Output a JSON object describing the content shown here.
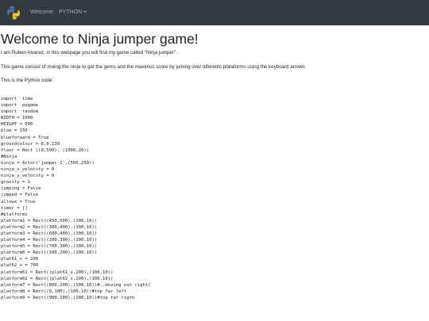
{
  "nav": {
    "items": [
      {
        "label": "Welcome"
      },
      {
        "label": "PYTHON"
      }
    ]
  },
  "page": {
    "title": "Welcome to Ninja jumper game!",
    "intro": "I am Ruben Alvarez, in this webpage you will find my game called \"Ninja jumper\" .",
    "description": "This game consist of moing the ninja to get the gems and the maximus score by juming over diferents plataforms using the keyboard arrows",
    "code_label": "This is the Python code:"
  },
  "code_lines": [
    "import  time",
    "import  pygame",
    "import  random",
    "WIDTH = 1000",
    "HEIGHT = 600",
    "blue = 150",
    "blueforward = True",
    "groundcolour = 0,0,139",
    "floor = Rect ((0,500), (1000,20))",
    "#Ninja",
    "ninja = Actor('jumper-1',(500,250))",
    "ninja_x_velocity = 0",
    "ninja_y_velocity = 0",
    "gravity = 1",
    "jumping = False",
    "jumped = False",
    "allowx = True",
    "timer = []",
    "#platforms",
    "platform1 = Rect((450,500),(100,10))",
    "platform2 = Rect((300,400),(100,10))",
    "platform3 = Rect((600,400),(100,10))",
    "platform4 = Rect((200,300),(100,10))",
    "platform5 = Rect((700,300),(100,10))",
    "platform6 = Rect((100,200),(100,10))",
    "plat61_x = 200",
    "plat62_x = 700",
    "platform61 = Rect((plat61_x,200),(100,10))",
    "platform62 = Rect((plat62_x,200),(100,10))",
    "platform7 = Rect((800,200),(100,10))#..moving out right(",
    "platform8 = Rect((0,100),(100,10))#top far left",
    "platform9 = Rect((900,100),(100,10))#top far rigth"
  ]
}
